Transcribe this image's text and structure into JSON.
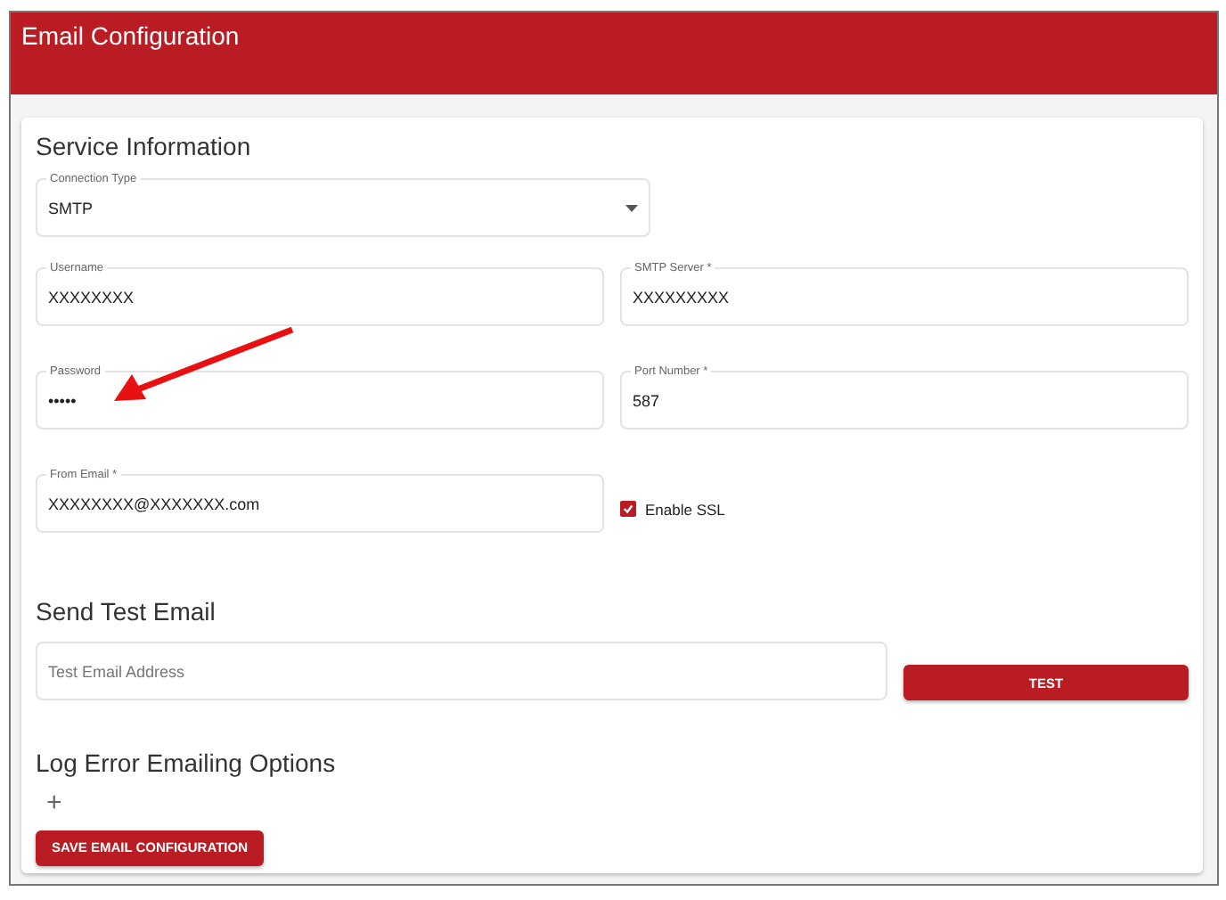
{
  "header": {
    "title": "Email Configuration"
  },
  "service": {
    "heading": "Service Information",
    "connection_type": {
      "label": "Connection Type",
      "value": "SMTP"
    },
    "fields": [
      {
        "label": "Username",
        "value": "XXXXXXXX"
      },
      {
        "label": "SMTP Server *",
        "value": "XXXXXXXXX"
      },
      {
        "label": "Password",
        "value": "•••••"
      },
      {
        "label": "Port Number *",
        "value": "587"
      },
      {
        "label": "From Email *",
        "value": "XXXXXXXX@XXXXXXX.com"
      }
    ],
    "enable_ssl": {
      "label": "Enable SSL",
      "checked": true
    }
  },
  "test": {
    "heading": "Send Test Email",
    "placeholder": "Test Email Address",
    "button": "TEST"
  },
  "log": {
    "heading": "Log Error Emailing Options",
    "add": "+"
  },
  "save_button": "SAVE EMAIL CONFIGURATION"
}
